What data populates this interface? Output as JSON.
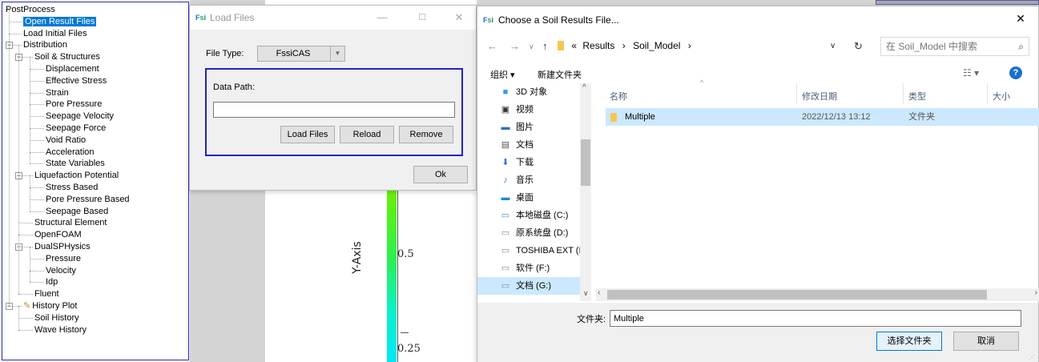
{
  "tree": {
    "items": [
      {
        "label": "PostProcess",
        "level": 0,
        "expander": false
      },
      {
        "label": "Open Result Files",
        "level": 1,
        "expander": false,
        "selected": true
      },
      {
        "label": "Load Initial Files",
        "level": 1,
        "expander": false
      },
      {
        "label": "Distribution",
        "level": 1,
        "expander": true
      },
      {
        "label": "Soil & Structures",
        "level": 2,
        "expander": true
      },
      {
        "label": "Displacement",
        "level": 3,
        "expander": false
      },
      {
        "label": "Effective Stress",
        "level": 3,
        "expander": false
      },
      {
        "label": "Strain",
        "level": 3,
        "expander": false
      },
      {
        "label": "Pore Pressure",
        "level": 3,
        "expander": false
      },
      {
        "label": "Seepage Velocity",
        "level": 3,
        "expander": false
      },
      {
        "label": "Seepage Force",
        "level": 3,
        "expander": false
      },
      {
        "label": "Void Ratio",
        "level": 3,
        "expander": false
      },
      {
        "label": "Acceleration",
        "level": 3,
        "expander": false
      },
      {
        "label": "State Variables",
        "level": 3,
        "expander": false
      },
      {
        "label": "Liquefaction Potential",
        "level": 2,
        "expander": true
      },
      {
        "label": "Stress Based",
        "level": 3,
        "expander": false
      },
      {
        "label": "Pore Pressure Based",
        "level": 3,
        "expander": false
      },
      {
        "label": "Seepage Based",
        "level": 3,
        "expander": false
      },
      {
        "label": "Structural Element",
        "level": 2,
        "expander": false
      },
      {
        "label": "OpenFOAM",
        "level": 2,
        "expander": false
      },
      {
        "label": "DualSPHysics",
        "level": 2,
        "expander": true
      },
      {
        "label": "Pressure",
        "level": 3,
        "expander": false
      },
      {
        "label": "Velocity",
        "level": 3,
        "expander": false
      },
      {
        "label": "Idp",
        "level": 3,
        "expander": false
      },
      {
        "label": "Fluent",
        "level": 2,
        "expander": false
      },
      {
        "label": "History Plot",
        "level": 1,
        "expander": true,
        "icon": "pencil-icon"
      },
      {
        "label": "Soil History",
        "level": 2,
        "expander": false
      },
      {
        "label": "Wave History",
        "level": 2,
        "expander": false
      }
    ]
  },
  "plot": {
    "yaxis_label": "Y-Axis",
    "tick_05": "0.5",
    "tick_025": "0.25"
  },
  "load_dialog": {
    "title": "Load Files",
    "file_type_label": "File Type:",
    "file_type_value": "FssiCAS",
    "data_path_label": "Data Path:",
    "data_path_value": "",
    "load_files_btn": "Load Files",
    "reload_btn": "Reload",
    "remove_btn": "Remove",
    "ok_btn": "Ok",
    "minimize_glyph": "—",
    "maximize_glyph": "☐",
    "close_glyph": "✕"
  },
  "file_dialog": {
    "title": "Choose a Soil Results File...",
    "close_glyph": "✕",
    "breadcrumb_prefix": "«",
    "breadcrumb": [
      "Results",
      "Soil_Model"
    ],
    "search_placeholder": "在 Soil_Model 中搜索",
    "organize": "组织 ▾",
    "new_folder": "新建文件夹",
    "nav_items": [
      {
        "label": "3D 对象",
        "icon": "3d-objects-icon"
      },
      {
        "label": "视频",
        "icon": "video-icon"
      },
      {
        "label": "图片",
        "icon": "pictures-icon"
      },
      {
        "label": "文档",
        "icon": "documents-icon"
      },
      {
        "label": "下载",
        "icon": "download-icon"
      },
      {
        "label": "音乐",
        "icon": "music-icon"
      },
      {
        "label": "桌面",
        "icon": "desktop-icon"
      },
      {
        "label": "本地磁盘 (C:)",
        "icon": "drive-c-icon"
      },
      {
        "label": "原系统盘 (D:)",
        "icon": "drive-icon"
      },
      {
        "label": "TOSHIBA EXT (I",
        "icon": "drive-icon"
      },
      {
        "label": "软件 (F:)",
        "icon": "drive-icon"
      },
      {
        "label": "文档 (G:)",
        "icon": "drive-icon",
        "selected": true
      }
    ],
    "columns": {
      "name": "名称",
      "modified": "修改日期",
      "type": "类型",
      "size": "大小"
    },
    "files": [
      {
        "name": "Multiple",
        "modified": "2022/12/13 13:12",
        "type": "文件夹"
      }
    ],
    "folder_label": "文件夹:",
    "folder_value": "Multiple",
    "select_btn": "选择文件夹",
    "cancel_btn": "取消"
  },
  "colors": {
    "accent": "#0078d7",
    "selection_bg": "#cce8ff",
    "group_border": "#2222c8"
  }
}
